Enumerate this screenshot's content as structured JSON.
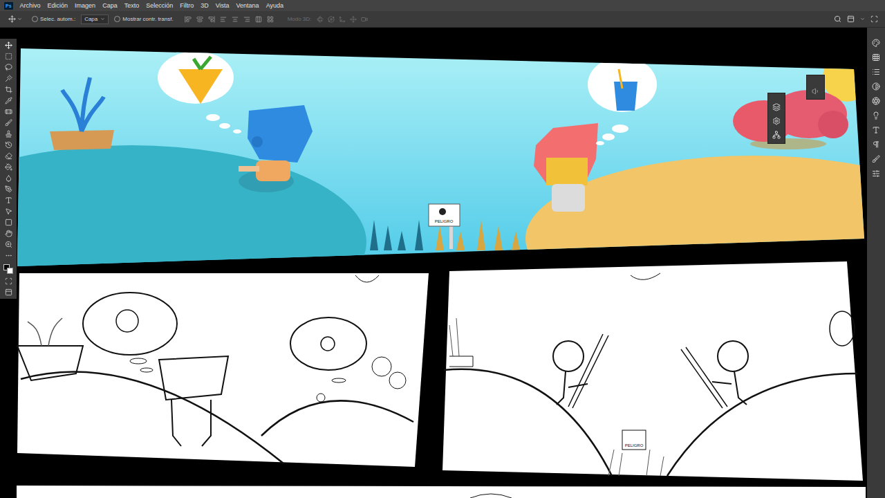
{
  "app": {
    "logo": "Ps"
  },
  "menu": [
    "Archivo",
    "Edición",
    "Imagen",
    "Capa",
    "Texto",
    "Selección",
    "Filtro",
    "3D",
    "Vista",
    "Ventana",
    "Ayuda"
  ],
  "options_bar": {
    "auto_select": {
      "label": "Selec. autom.:",
      "checked": false
    },
    "target": "Capa",
    "show_transform": {
      "label": "Mostrar contr. transf.",
      "checked": false
    },
    "mode_3d": {
      "label": "Modo 3D:",
      "disabled": true
    }
  },
  "artwork": {
    "signs": [
      "PELIGRO",
      "PELIGRO"
    ]
  }
}
